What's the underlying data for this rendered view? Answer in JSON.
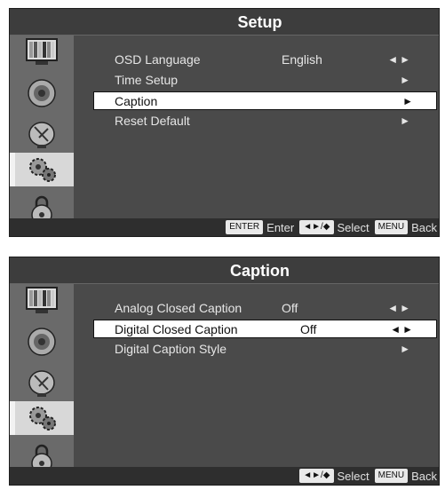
{
  "panel_setup": {
    "title": "Setup",
    "rows": [
      {
        "label": "OSD Language",
        "value": "English",
        "arrows": "◄►"
      },
      {
        "label": "Time Setup",
        "value": "",
        "arrows": "►"
      },
      {
        "label": "Caption",
        "value": "",
        "arrows": "►"
      },
      {
        "label": "Reset Default",
        "value": "",
        "arrows": "►"
      }
    ],
    "footer": {
      "enter_key": "ENTER",
      "enter_label": "Enter",
      "select_key": "◄►/◆",
      "select_label": "Select",
      "menu_key": "MENU",
      "menu_label": "Back"
    }
  },
  "panel_caption": {
    "title": "Caption",
    "rows": [
      {
        "label": "Analog Closed Caption",
        "value": "Off",
        "arrows": "◄►"
      },
      {
        "label": "Digital Closed Caption",
        "value": "Off",
        "arrows": "◄►"
      },
      {
        "label": "Digital Caption Style",
        "value": "",
        "arrows": "►"
      }
    ],
    "footer": {
      "select_key": "◄►/◆",
      "select_label": "Select",
      "menu_key": "MENU",
      "menu_label": "Back"
    }
  },
  "sidebar_icons": [
    "picture-icon",
    "audio-icon",
    "channel-icon",
    "setup-gear-icon",
    "lock-icon"
  ],
  "colors": {
    "panel_bg": "#4a4a4a",
    "highlight_bg": "#ffffff",
    "sidebar_selected": "#d8d8d8"
  }
}
